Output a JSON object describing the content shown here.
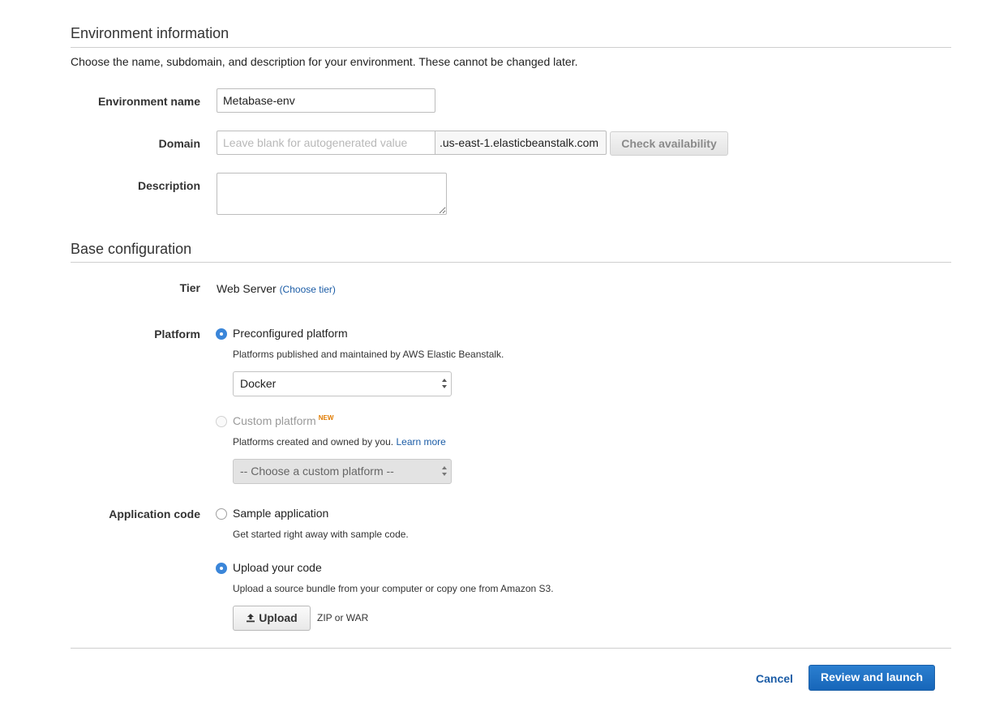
{
  "environment": {
    "section_title": "Environment information",
    "description": "Choose the name, subdomain, and description for your environment. These cannot be changed later.",
    "name_label": "Environment name",
    "name_value": "Metabase-env",
    "domain_label": "Domain",
    "domain_placeholder": "Leave blank for autogenerated value",
    "domain_suffix": ".us-east-1.elasticbeanstalk.com",
    "check_button": "Check availability",
    "description_label": "Description",
    "description_value": ""
  },
  "base": {
    "section_title": "Base configuration",
    "tier_label": "Tier",
    "tier_value": "Web Server",
    "choose_tier_link": "(Choose tier)",
    "platform_label": "Platform",
    "preconfigured": {
      "label": "Preconfigured platform",
      "help": "Platforms published and maintained by AWS Elastic Beanstalk.",
      "selected": "Docker",
      "checked": true
    },
    "custom": {
      "label": "Custom platform",
      "badge": "NEW",
      "help": "Platforms created and owned by you.",
      "learn_more": "Learn more",
      "selected": "-- Choose a custom platform --",
      "checked": false
    },
    "app_code_label": "Application code",
    "sample": {
      "label": "Sample application",
      "help": "Get started right away with sample code.",
      "checked": false
    },
    "upload": {
      "label": "Upload your code",
      "help": "Upload a source bundle from your computer or copy one from Amazon S3.",
      "button": "Upload",
      "hint": "ZIP or WAR",
      "checked": true
    }
  },
  "footer": {
    "cancel": "Cancel",
    "review_launch": "Review and launch"
  },
  "colors": {
    "primary": "#1766b9",
    "link": "#1b5ca6",
    "radio_checked": "#3b86d9",
    "new_badge": "#e07b00"
  }
}
